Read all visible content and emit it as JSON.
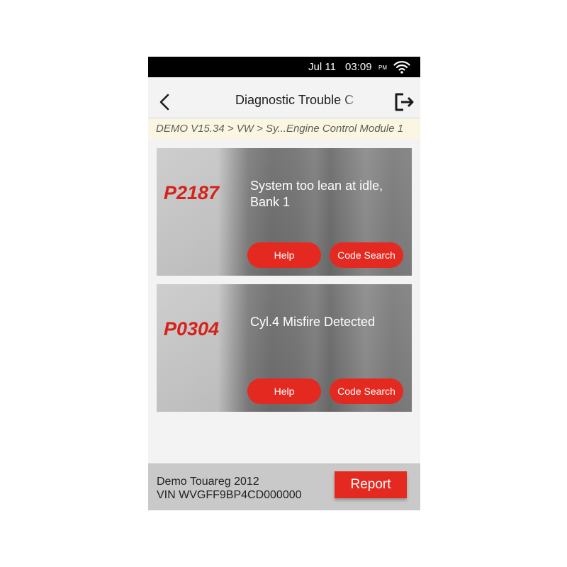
{
  "status_bar": {
    "date": "Jul 11",
    "time": "03:09",
    "ampm": "PM"
  },
  "header": {
    "title": "Diagnostic Trouble C"
  },
  "breadcrumb": "DEMO V15.34 > VW > Sy...Engine Control Module 1",
  "dtc_list": [
    {
      "code": "P2187",
      "description": "System too lean at idle, Bank 1",
      "help_label": "Help",
      "search_label": "Code Search"
    },
    {
      "code": "P0304",
      "description": "Cyl.4 Misfire Detected",
      "help_label": "Help",
      "search_label": "Code Search"
    }
  ],
  "footer": {
    "vehicle": "Demo Touareg  2012",
    "vin": "VIN WVGFF9BP4CD000000",
    "report_label": "Report"
  },
  "colors": {
    "accent": "#e42a20",
    "code_text": "#d5221a",
    "breadcrumb_bg": "#fbf6e2"
  }
}
